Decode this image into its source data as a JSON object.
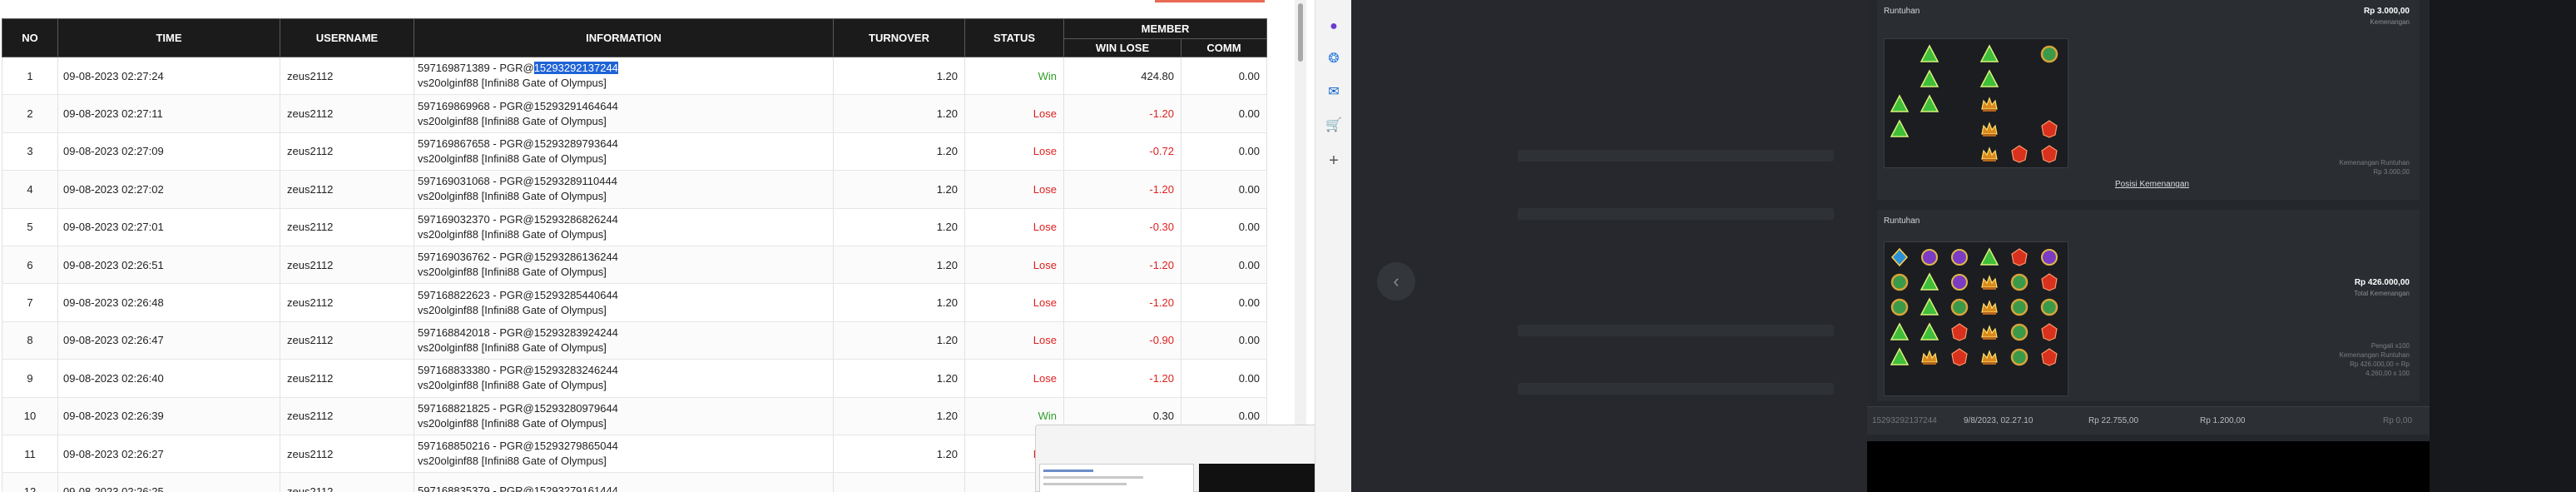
{
  "table": {
    "headers": {
      "no": "NO",
      "time": "TIME",
      "username": "USERNAME",
      "information": "INFORMATION",
      "turnover": "TURNOVER",
      "status": "STATUS",
      "member": "MEMBER",
      "win_lose": "WIN LOSE",
      "comm": "COMM"
    },
    "rows": [
      {
        "no": "1",
        "time": "09-08-2023 02:27:24",
        "username": "zeus2112",
        "info_pre": "597169871389 - PGR@",
        "info_id": "15293292137244",
        "game": "vs20olginf88 [Infini88 Gate of Olympus]",
        "turnover": "1.20",
        "status": "Win",
        "winlose": "424.80",
        "comm": "0.00",
        "highlight": true
      },
      {
        "no": "2",
        "time": "09-08-2023 02:27:11",
        "username": "zeus2112",
        "info_pre": "597169869968 - PGR@",
        "info_id": "15293291464644",
        "game": "vs20olginf88 [Infini88 Gate of Olympus]",
        "turnover": "1.20",
        "status": "Lose",
        "winlose": "-1.20",
        "comm": "0.00"
      },
      {
        "no": "3",
        "time": "09-08-2023 02:27:09",
        "username": "zeus2112",
        "info_pre": "597169867658 - PGR@",
        "info_id": "15293289793644",
        "game": "vs20olginf88 [Infini88 Gate of Olympus]",
        "turnover": "1.20",
        "status": "Lose",
        "winlose": "-0.72",
        "comm": "0.00"
      },
      {
        "no": "4",
        "time": "09-08-2023 02:27:02",
        "username": "zeus2112",
        "info_pre": "597169031068 - PGR@",
        "info_id": "15293289110444",
        "game": "vs20olginf88 [Infini88 Gate of Olympus]",
        "turnover": "1.20",
        "status": "Lose",
        "winlose": "-1.20",
        "comm": "0.00"
      },
      {
        "no": "5",
        "time": "09-08-2023 02:27:01",
        "username": "zeus2112",
        "info_pre": "597169032370 - PGR@",
        "info_id": "15293286826244",
        "game": "vs20olginf88 [Infini88 Gate of Olympus]",
        "turnover": "1.20",
        "status": "Lose",
        "winlose": "-0.30",
        "comm": "0.00"
      },
      {
        "no": "6",
        "time": "09-08-2023 02:26:51",
        "username": "zeus2112",
        "info_pre": "597169036762 - PGR@",
        "info_id": "15293286136244",
        "game": "vs20olginf88 [Infini88 Gate of Olympus]",
        "turnover": "1.20",
        "status": "Lose",
        "winlose": "-1.20",
        "comm": "0.00"
      },
      {
        "no": "7",
        "time": "09-08-2023 02:26:48",
        "username": "zeus2112",
        "info_pre": "597168822623 - PGR@",
        "info_id": "15293285440644",
        "game": "vs20olginf88 [Infini88 Gate of Olympus]",
        "turnover": "1.20",
        "status": "Lose",
        "winlose": "-1.20",
        "comm": "0.00"
      },
      {
        "no": "8",
        "time": "09-08-2023 02:26:47",
        "username": "zeus2112",
        "info_pre": "597168842018 - PGR@",
        "info_id": "15293283924244",
        "game": "vs20olginf88 [Infini88 Gate of Olympus]",
        "turnover": "1.20",
        "status": "Lose",
        "winlose": "-0.90",
        "comm": "0.00"
      },
      {
        "no": "9",
        "time": "09-08-2023 02:26:40",
        "username": "zeus2112",
        "info_pre": "597168833380 - PGR@",
        "info_id": "15293283246244",
        "game": "vs20olginf88 [Infini88 Gate of Olympus]",
        "turnover": "1.20",
        "status": "Lose",
        "winlose": "-1.20",
        "comm": "0.00"
      },
      {
        "no": "10",
        "time": "09-08-2023 02:26:39",
        "username": "zeus2112",
        "info_pre": "597168821825 - PGR@",
        "info_id": "15293280979644",
        "game": "vs20olginf88 [Infini88 Gate of Olympus]",
        "turnover": "1.20",
        "status": "Win",
        "winlose": "0.30",
        "comm": "0.00"
      },
      {
        "no": "11",
        "time": "09-08-2023 02:26:27",
        "username": "zeus2112",
        "info_pre": "597168850216 - PGR@",
        "info_id": "15293279865044",
        "game": "vs20olginf88 [Infini88 Gate of Olympus]",
        "turnover": "1.20",
        "status": "Lose",
        "winlose": "",
        "comm": "0.00"
      },
      {
        "no": "12",
        "time": "09-08-2023 02:26:25",
        "username": "zeus2112",
        "info_pre": "597168835379 - PGR@",
        "info_id": "15293279161444",
        "game": "",
        "turnover": "",
        "status": "",
        "winlose": "",
        "comm": ""
      }
    ]
  },
  "colors": {
    "win": "#2f9e28",
    "lose": "#e02020",
    "header_bg": "#1b1b1b",
    "highlight": "#1f63d6"
  },
  "side_toolbar": {
    "icons": [
      "people-icon",
      "copilot-icon",
      "outlook-icon",
      "shopping-icon",
      "add-icon"
    ]
  },
  "game": {
    "tumble1": {
      "title": "Runtuhan",
      "amount": "Rp 3.000,00",
      "amount_sub": "Kemenangan",
      "detail_line1": "Kemenangan Runtuhan",
      "detail_line2": "Rp 3.000,00",
      "link": "Posisi Kemenangan"
    },
    "tumble2": {
      "title": "Runtuhan",
      "amount": "Rp 426.000,00",
      "amount_sub": "Total Kemenangan",
      "detail_line1": "Pengali x100",
      "detail_line2": "Kemenangan Runtuhan",
      "detail_line3": "Rp 426.000,00 = Rp",
      "detail_line4": "4.260,00 x 100"
    },
    "footer": {
      "round_id": "15293292137244",
      "datetime": "9/8/2023, 02.27.10",
      "balance": "Rp 22.755,00",
      "bet": "Rp 1.200,00",
      "win": "Rp 0,00"
    }
  }
}
